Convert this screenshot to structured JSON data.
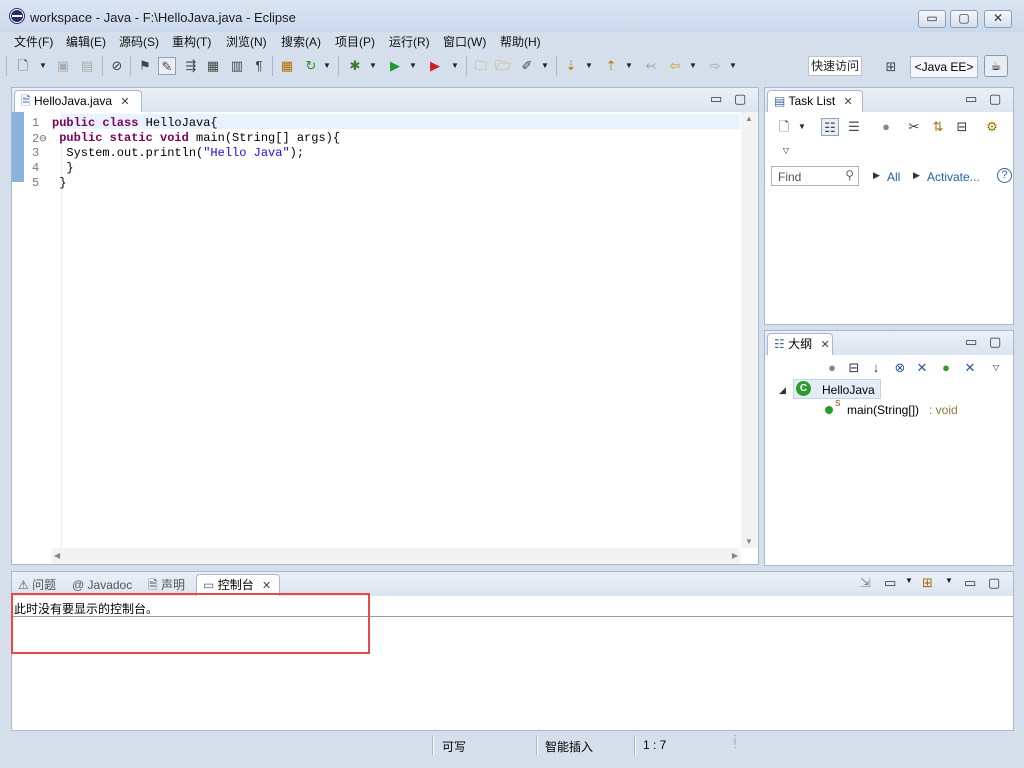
{
  "window": {
    "title": "workspace  -  Java  -  F:\\HelloJava.java  -  Eclipse",
    "minimize": "▭",
    "maximize": "▢",
    "close": "✕"
  },
  "menu": [
    "文件(F)",
    "编辑(E)",
    "源码(S)",
    "重构(T)",
    "浏览(N)",
    "搜索(A)",
    "项目(P)",
    "运行(R)",
    "窗口(W)",
    "帮助(H)"
  ],
  "toolbar": {
    "quick_access": "快速访问",
    "perspective": "<Java EE>"
  },
  "editor": {
    "tab_label": "HelloJava.java",
    "line_numbers": [
      "1",
      "2⊖",
      "3",
      "4",
      "5"
    ],
    "code": {
      "l1_kw": "public class ",
      "l1_rest": "HelloJava{",
      "l2_kw": " public static void ",
      "l2_rest": "main(String[] args){",
      "l3_pre": "  System.out.println(",
      "l3_str": "\"Hello Java\"",
      "l3_post": ");",
      "l4": "  }",
      "l5": " }"
    }
  },
  "tasklist": {
    "tab_label": "Task List",
    "find_placeholder": "Find",
    "all_label": "All",
    "activate_label": "Activate...",
    "help": "?"
  },
  "outline": {
    "tab_label": "大纲",
    "class_name": "HelloJava",
    "method_name": "main(String[])",
    "method_type": " : void"
  },
  "console": {
    "tabs": [
      "问题",
      "Javadoc",
      "声明",
      "控制台"
    ],
    "message": "此时没有要显示的控制台。"
  },
  "status": {
    "writable": "可写",
    "insert_mode": "智能插入",
    "position": "1 : 7"
  },
  "colors": {
    "keyword": "#7f0055",
    "string": "#2a00ff",
    "highlight_box": "#e74848",
    "ruler": "#8ab4de"
  }
}
